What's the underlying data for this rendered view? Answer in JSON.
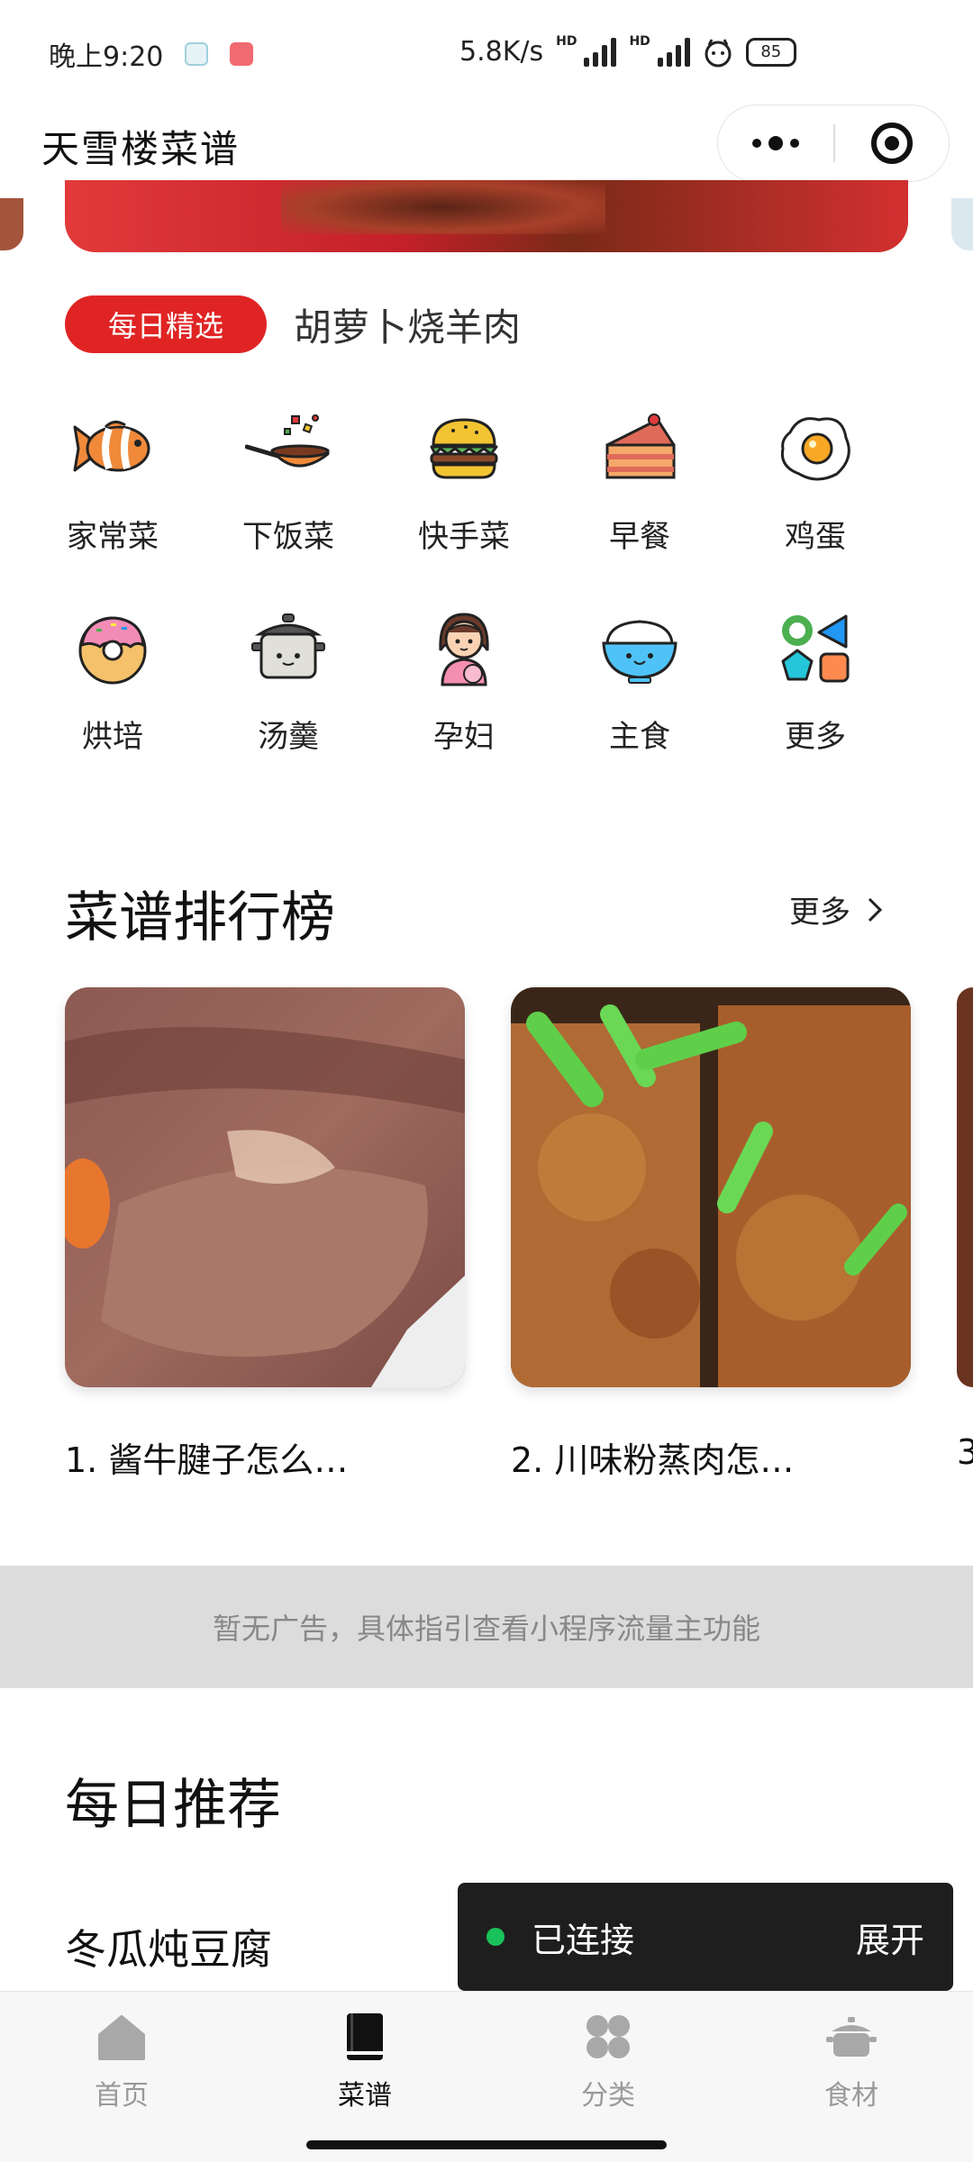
{
  "status_bar": {
    "time": "晚上9:20",
    "network_speed": "5.8K/s",
    "hd_label": "HD",
    "battery": "85"
  },
  "header": {
    "title": "天雪楼菜谱"
  },
  "daily_pick": {
    "badge": "每日精选",
    "title": "胡萝卜烧羊肉"
  },
  "categories": [
    {
      "label": "家常菜",
      "icon": "fish-icon"
    },
    {
      "label": "下饭菜",
      "icon": "wok-icon"
    },
    {
      "label": "快手菜",
      "icon": "burger-icon"
    },
    {
      "label": "早餐",
      "icon": "cake-icon"
    },
    {
      "label": "鸡蛋",
      "icon": "fried-egg-icon"
    },
    {
      "label": "烘培",
      "icon": "donut-icon"
    },
    {
      "label": "汤羹",
      "icon": "soup-pot-icon"
    },
    {
      "label": "孕妇",
      "icon": "pregnant-woman-icon"
    },
    {
      "label": "主食",
      "icon": "rice-bowl-icon"
    },
    {
      "label": "更多",
      "icon": "shapes-icon"
    }
  ],
  "ranking": {
    "title": "菜谱排行榜",
    "more": "更多",
    "items": [
      {
        "label": "1. 酱牛腱子怎么…"
      },
      {
        "label": "2. 川味粉蒸肉怎…"
      }
    ],
    "peek_label": "3"
  },
  "ad": {
    "text": "暂无广告，具体指引查看小程序流量主功能"
  },
  "recommend": {
    "title": "每日推荐",
    "first_item": "冬瓜炖豆腐"
  },
  "toast": {
    "status": "已连接",
    "action": "展开"
  },
  "tabs": [
    {
      "label": "首页",
      "icon": "home-icon",
      "active": false
    },
    {
      "label": "菜谱",
      "icon": "book-icon",
      "active": true
    },
    {
      "label": "分类",
      "icon": "grid-icon",
      "active": false
    },
    {
      "label": "食材",
      "icon": "pot-icon",
      "active": false
    }
  ],
  "colors": {
    "accent": "#e02424",
    "tab_active": "#111111",
    "tab_inactive": "#999999"
  }
}
